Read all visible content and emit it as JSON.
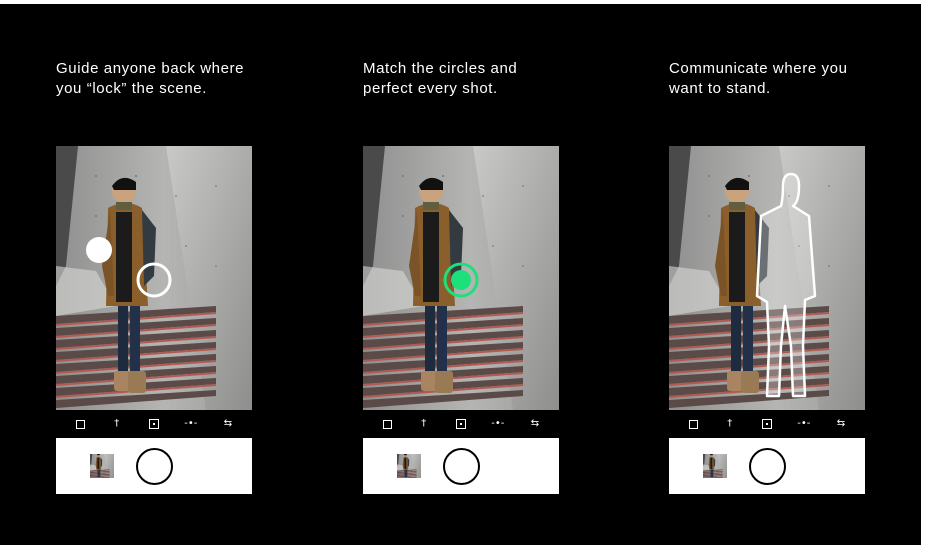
{
  "panels": [
    {
      "caption": [
        "Guide anyone back where",
        "you “lock” the scene."
      ],
      "overlay": "lock-circles"
    },
    {
      "caption": [
        "Match the circles and",
        "perfect every shot."
      ],
      "overlay": "matched-circle"
    },
    {
      "caption": [
        "Communicate where you",
        "want to stand."
      ],
      "overlay": "person-outline"
    }
  ],
  "toolbar_icons": [
    "square-frame-icon",
    "person-pin-icon",
    "focus-box-icon",
    "level-icon",
    "switch-camera-icon"
  ],
  "toolbar_glyphs": {
    "person": "†",
    "level": "-•-",
    "switch": "⇆"
  },
  "colors": {
    "background": "#000000",
    "match_accent": "#1ee07a",
    "caption": "#ffffff"
  }
}
